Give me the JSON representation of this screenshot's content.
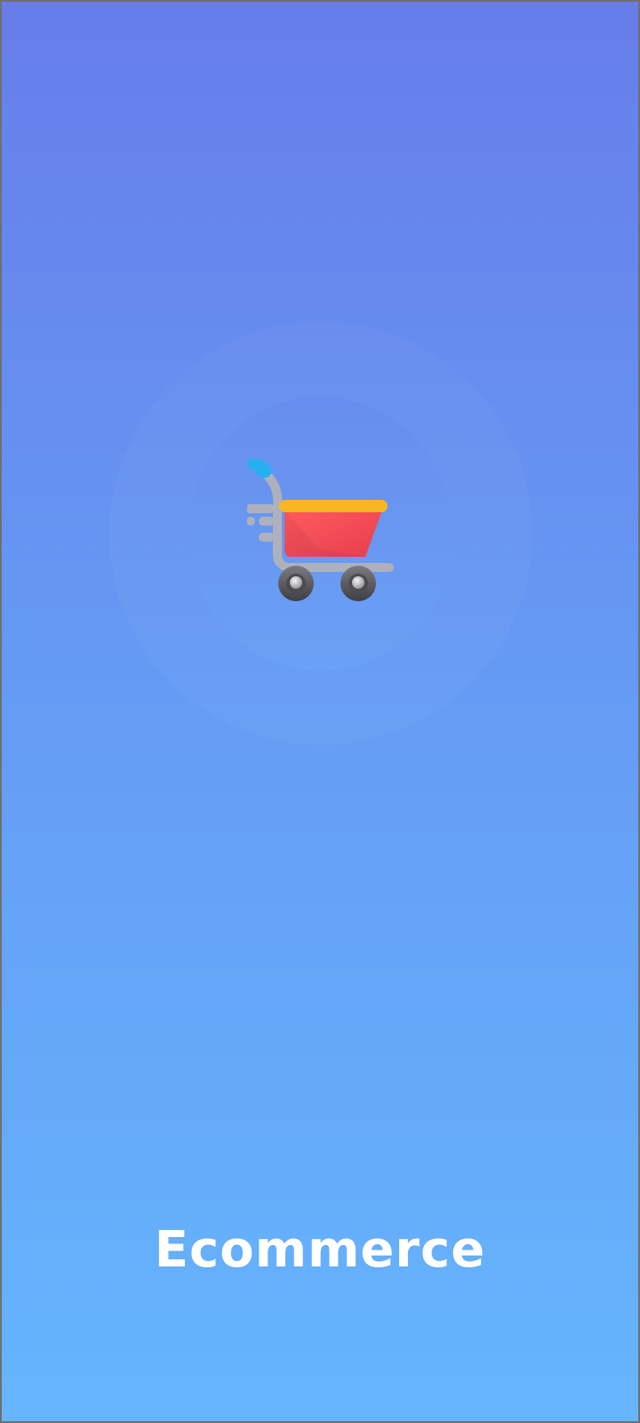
{
  "splash": {
    "app_name": "Ecommerce",
    "logo_icon": "shopping-cart-icon"
  },
  "colors": {
    "gradient_top": "#667dea",
    "gradient_bottom": "#65b5fd",
    "cart_basket": "#ee4650",
    "cart_rim": "#f8b623",
    "cart_handle": "#26b0f0",
    "cart_frame": "#aeb1bd",
    "wheel": "#5f5f63",
    "title_text": "#ffffff"
  }
}
